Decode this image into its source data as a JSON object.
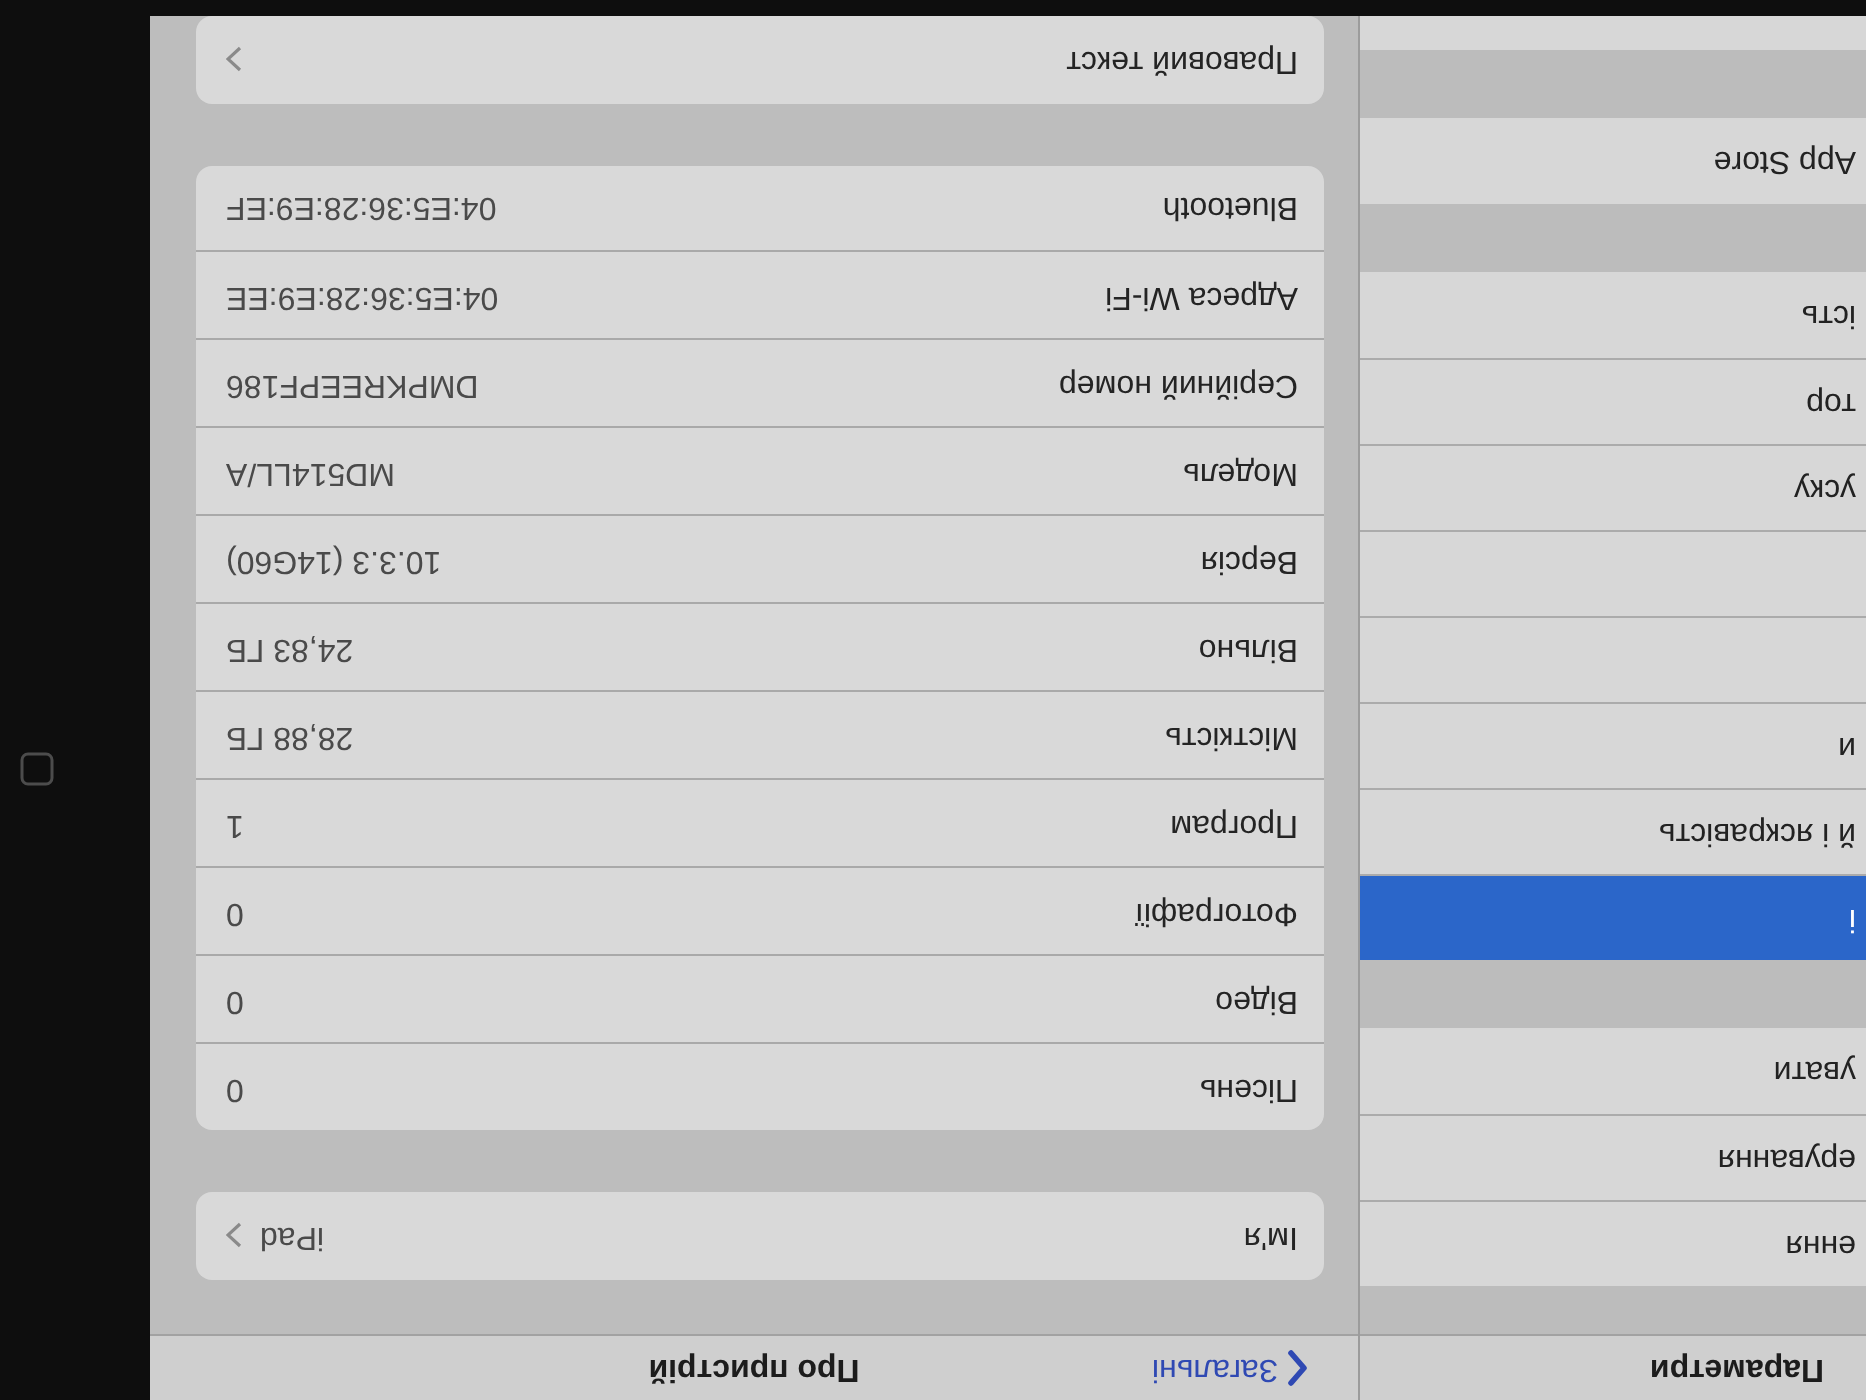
{
  "sidebar": {
    "title": "Параметри",
    "groups": [
      {
        "items": [
          {
            "label": "ення",
            "selected": false
          },
          {
            "label": "ерування",
            "selected": false
          },
          {
            "label": "увати",
            "selected": false
          }
        ]
      },
      {
        "items": [
          {
            "label": "і",
            "selected": true
          },
          {
            "label": "й і яскравість",
            "selected": false
          },
          {
            "label": "и",
            "selected": false
          },
          {
            "selected": false
          },
          {
            "selected": false
          },
          {
            "label": "уску",
            "selected": false
          },
          {
            "label": "тор",
            "selected": false
          },
          {
            "label": "ість",
            "selected": false
          }
        ]
      },
      {
        "items": [
          {
            "label": "App Store",
            "selected": false
          }
        ]
      },
      {
        "items": [
          {
            "selected": false
          }
        ]
      }
    ]
  },
  "detail": {
    "back_button": "Загальні",
    "title": "Про пристрій",
    "groups": [
      {
        "rows": [
          {
            "kind": "link",
            "label": "Ім'я",
            "value": "iPad"
          }
        ]
      },
      {
        "rows": [
          {
            "kind": "info",
            "label": "Пісень",
            "value": "0"
          },
          {
            "kind": "info",
            "label": "Відео",
            "value": "0"
          },
          {
            "kind": "info",
            "label": "Фотографії",
            "value": "0"
          },
          {
            "kind": "info",
            "label": "Програм",
            "value": "1"
          },
          {
            "kind": "info",
            "label": "Місткість",
            "value": "28,88 ГБ"
          },
          {
            "kind": "info",
            "label": "Вільно",
            "value": "24,83 ГБ"
          },
          {
            "kind": "info",
            "label": "Версія",
            "value": "10.3.3 (14G60)"
          },
          {
            "kind": "info",
            "label": "Модель",
            "value": "MD514LL/A"
          },
          {
            "kind": "info",
            "label": "Серійний номер",
            "value": "DMPKREEPF186"
          },
          {
            "kind": "info",
            "label": "Адреса Wi-Fi",
            "value": "04:E5:36:28:E9:EE"
          },
          {
            "kind": "info",
            "label": "Bluetooth",
            "value": "04:E5:36:28:E9:EF"
          }
        ]
      },
      {
        "rows": [
          {
            "kind": "link",
            "label": "Правовий текст"
          }
        ]
      }
    ]
  }
}
